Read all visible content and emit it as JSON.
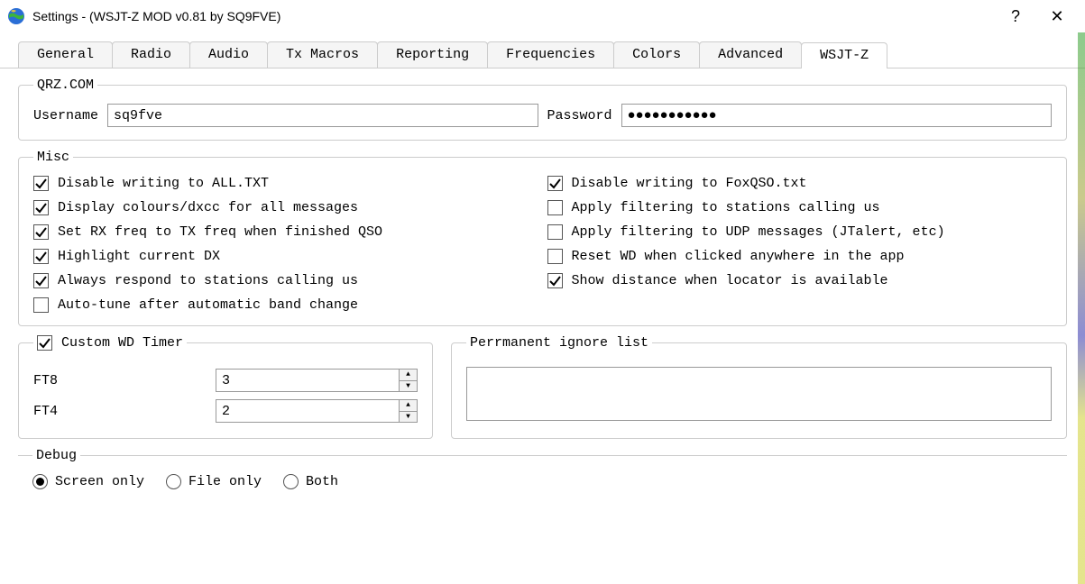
{
  "window": {
    "title": "Settings - (WSJT-Z MOD v0.81 by SQ9FVE)",
    "help_glyph": "?",
    "close_glyph": "✕"
  },
  "tabs": [
    {
      "label": "General"
    },
    {
      "label": "Radio"
    },
    {
      "label": "Audio"
    },
    {
      "label": "Tx Macros"
    },
    {
      "label": "Reporting"
    },
    {
      "label": "Frequencies"
    },
    {
      "label": "Colors"
    },
    {
      "label": "Advanced"
    },
    {
      "label": "WSJT-Z"
    }
  ],
  "active_tab": "WSJT-Z",
  "qrz": {
    "legend": "QRZ.COM",
    "username_label": "Username",
    "username_value": "sq9fve",
    "password_label": "Password",
    "password_value": "●●●●●●●●●●●"
  },
  "misc": {
    "legend": "Misc",
    "left": [
      {
        "label": "Disable writing to ALL.TXT",
        "checked": true
      },
      {
        "label": "Display colours/dxcc for all messages",
        "checked": true
      },
      {
        "label": "Set RX freq to TX freq when finished QSO",
        "checked": true
      },
      {
        "label": "Highlight current DX",
        "checked": true
      },
      {
        "label": "Always respond to stations calling us",
        "checked": true
      },
      {
        "label": "Auto-tune after automatic band change",
        "checked": false
      }
    ],
    "right": [
      {
        "label": "Disable writing to FoxQSO.txt",
        "checked": true
      },
      {
        "label": "Apply filtering to stations calling us",
        "checked": false
      },
      {
        "label": "Apply filtering to UDP messages (JTalert, etc)",
        "checked": false
      },
      {
        "label": "Reset WD when clicked anywhere in the app",
        "checked": false
      },
      {
        "label": "Show distance when locator is available",
        "checked": true
      }
    ]
  },
  "wd": {
    "legend_checkbox_label": "Custom WD Timer",
    "legend_checked": true,
    "ft8_label": "FT8",
    "ft8_value": "3",
    "ft4_label": "FT4",
    "ft4_value": "2"
  },
  "ignore": {
    "legend": "Perrmanent ignore list",
    "value": ""
  },
  "debug": {
    "legend": "Debug",
    "options": [
      {
        "label": "Screen only",
        "selected": true
      },
      {
        "label": "File only",
        "selected": false
      },
      {
        "label": "Both",
        "selected": false
      }
    ]
  }
}
